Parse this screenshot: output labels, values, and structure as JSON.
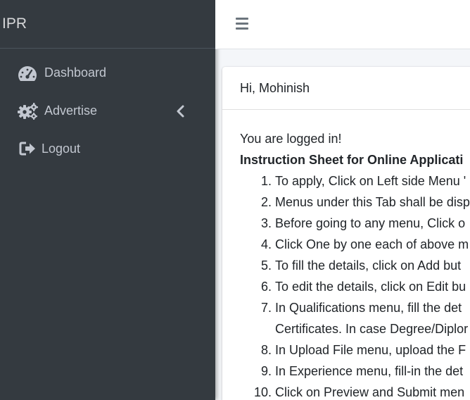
{
  "brand": {
    "title": "IPR"
  },
  "sidebar": {
    "items": [
      {
        "label": "Dashboard",
        "icon": "tachometer-icon"
      },
      {
        "label": "Advertise",
        "icon": "cogs-icon",
        "has_submenu": true
      },
      {
        "label": "Logout",
        "icon": "sign-out-icon"
      }
    ]
  },
  "card": {
    "greeting": "Hi, Mohinish",
    "logged_in": "You are logged in!",
    "instruction_title": "Instruction Sheet for Online Applicati",
    "steps": [
      {
        "num": "1.",
        "text": "To apply, Click on Left side Menu '"
      },
      {
        "num": "2.",
        "text": "Menus under this Tab shall be disp"
      },
      {
        "num": "3.",
        "text": "Before going to any menu, Click o"
      },
      {
        "num": "4.",
        "text": "Click One by one each of above m"
      },
      {
        "num": "5.",
        "text": "To fill the details, click on Add but"
      },
      {
        "num": "6.",
        "text": "To edit the details, click on Edit bu"
      },
      {
        "num": "7.",
        "text": "In Qualifications menu, fill the det",
        "cont": "Certificates. In case Degree/Diplor"
      },
      {
        "num": "8.",
        "text": "In Upload File menu, upload the F"
      },
      {
        "num": "9.",
        "text": "In Experience menu, fill-in the det"
      },
      {
        "num": "10.",
        "text": "Click on Preview and Submit men"
      }
    ]
  },
  "colors": {
    "sidebar_bg": "#343a40",
    "sidebar_text": "#c2c7d0",
    "content_bg": "#f4f6f9"
  }
}
